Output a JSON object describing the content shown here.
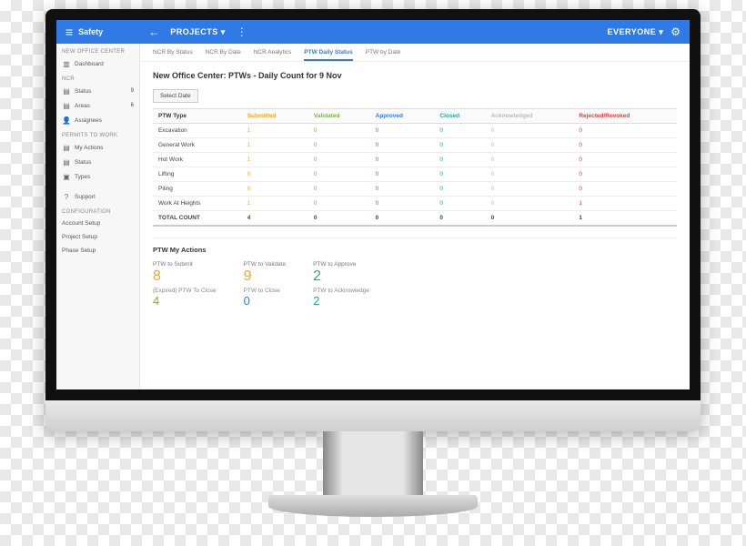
{
  "header": {
    "app": "Safety",
    "projects": "PROJECTS ▾",
    "user": "EVERYONE ▾"
  },
  "sidebar": {
    "sec1": "NEW OFFICE CENTER",
    "dashboard": "Dashboard",
    "sec2": "NCR",
    "status": "Status",
    "status_n": "9",
    "areas": "Areas",
    "areas_n": "6",
    "assignees": "Assignees",
    "sec3": "PERMITS TO WORK",
    "myactions": "My Actions",
    "pstatus": "Status",
    "types": "Types",
    "support": "Support",
    "sec4": "CONFIGURATION",
    "acct": "Account Setup",
    "proj": "Project Setup",
    "phase": "Phase Setup"
  },
  "tabs": [
    "NCR By Status",
    "NCR By Date",
    "NCR Analytics",
    "PTW Daily Status",
    "PTW by Date"
  ],
  "active_tab": 3,
  "page_title": "New Office Center: PTWs - Daily Count for 9 Nov",
  "select_date": "Select Date",
  "columns": [
    "PTW Type",
    "Submitted",
    "Validated",
    "Approved",
    "Closed",
    "Acknowledged",
    "Rejected/Revoked"
  ],
  "rows": [
    {
      "type": "Excavation",
      "v": [
        1,
        0,
        0,
        0,
        0,
        0
      ]
    },
    {
      "type": "General Work",
      "v": [
        1,
        0,
        0,
        0,
        0,
        0
      ]
    },
    {
      "type": "Hot Work",
      "v": [
        1,
        0,
        0,
        0,
        0,
        0
      ]
    },
    {
      "type": "Lifting",
      "v": [
        0,
        0,
        0,
        0,
        0,
        0
      ]
    },
    {
      "type": "Piling",
      "v": [
        0,
        0,
        0,
        0,
        0,
        0
      ]
    },
    {
      "type": "Work At Heights",
      "v": [
        1,
        0,
        0,
        0,
        0,
        1
      ]
    }
  ],
  "total_label": "TOTAL COUNT",
  "totals": [
    4,
    0,
    0,
    0,
    0,
    1
  ],
  "actions_title": "PTW My Actions",
  "actions": {
    "a_label": "PTW to Submit",
    "a_val": "8",
    "a_sub": "(Expired) PTW To Close",
    "a_sub_val": "4",
    "b_label": "PTW to Validate",
    "b_val": "9",
    "b_sub": "PTW to Close",
    "b_sub_val": "0",
    "c_label": "PTW to Approve",
    "c_val": "2",
    "c_sub": "PTW to Acknowledge",
    "c_sub_val": "2"
  }
}
